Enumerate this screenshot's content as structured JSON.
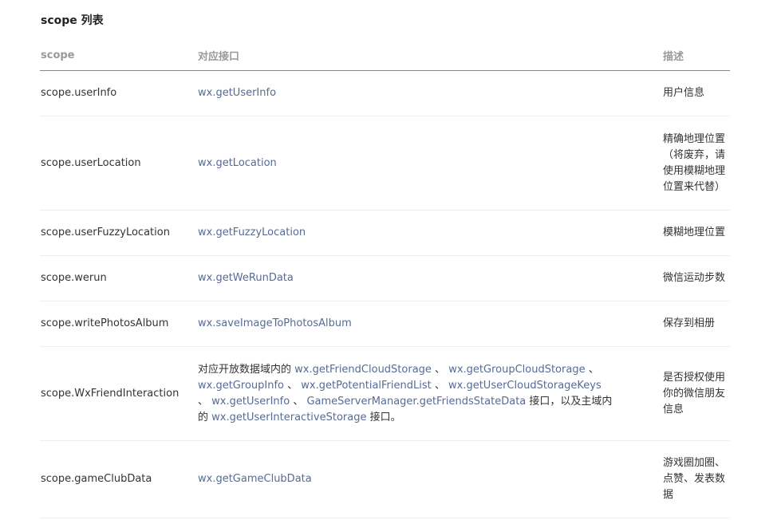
{
  "page": {
    "heading": "scope 列表"
  },
  "table": {
    "headers": [
      "scope",
      "对应接口",
      "描述"
    ],
    "rows": [
      {
        "scope": "scope.userInfo",
        "api": "wx.getUserInfo",
        "desc": "用户信息"
      },
      {
        "scope": "scope.userLocation",
        "api": "wx.getLocation",
        "desc": "精确地理位置（将废弃，请使用模糊地理位置来代替）"
      },
      {
        "scope": "scope.userFuzzyLocation",
        "api": "wx.getFuzzyLocation",
        "desc": "模糊地理位置"
      },
      {
        "scope": "scope.werun",
        "api": "wx.getWeRunData",
        "desc": "微信运动步数"
      },
      {
        "scope": "scope.writePhotosAlbum",
        "api": "wx.saveImageToPhotosAlbum",
        "desc": "保存到相册"
      },
      {
        "scope": "scope.WxFriendInteraction",
        "api_rich": {
          "prefix": "对应开放数据域内的 ",
          "apis": [
            "wx.getFriendCloudStorage",
            "wx.getGroupCloudStorage",
            "wx.getGroupInfo",
            "wx.getPotentialFriendList",
            "wx.getUserCloudStorageKeys",
            "wx.getUserInfo",
            "GameServerManager.getFriendsStateData"
          ],
          "separator": " 、 ",
          "middle": " 接口，以及主域内的 ",
          "last_api": "wx.getUserInteractiveStorage",
          "suffix": " 接口。"
        },
        "desc": "是否授权使用你的微信朋友信息"
      },
      {
        "scope": "scope.gameClubData",
        "api": "wx.getGameClubData",
        "desc": "游戏圈加圈、点赞、发表数据"
      }
    ]
  },
  "colors": {
    "link": "#576b95",
    "text": "#333333",
    "header_text": "#999999"
  }
}
